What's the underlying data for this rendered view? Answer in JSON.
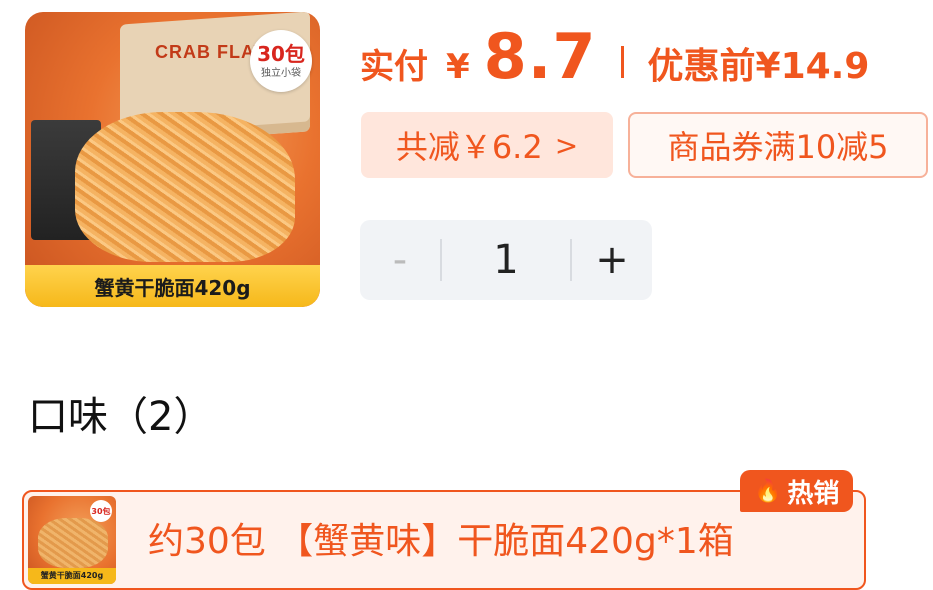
{
  "product": {
    "image_caption": "蟹黄干脆面420g",
    "badge_count": "30包",
    "badge_sub": "独立小袋",
    "brand_text": "CRAB FLAVOR"
  },
  "price": {
    "paid_label": "实付",
    "currency": "¥",
    "paid_amount": "8.7",
    "original_label": "优惠前",
    "original_amount": "¥14.9"
  },
  "discount": {
    "total_label": "共减￥6.2",
    "chevron": ">",
    "coupon_label": "商品券满10减5"
  },
  "quantity": {
    "minus": "-",
    "value": "1",
    "plus": "+"
  },
  "flavor": {
    "section_title": "口味（2）",
    "option_text": "约30包 【蟹黄味】干脆面420g*1箱",
    "option_thumb_caption": "蟹黄干脆面420g",
    "option_thumb_badge": "30包",
    "hot_tag": "热销"
  },
  "colors": {
    "accent": "#f0561e",
    "accent_light": "#ffe6dc",
    "stepper_bg": "#f1f3f6"
  }
}
